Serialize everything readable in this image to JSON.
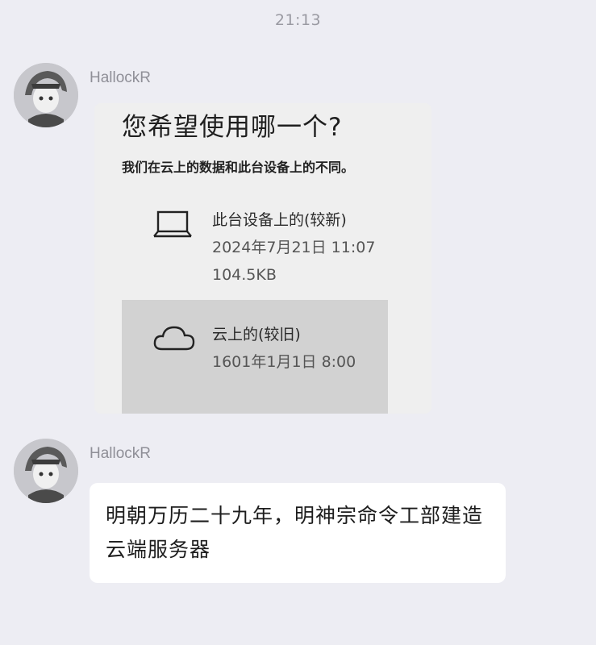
{
  "chat": {
    "timestamp": "21:13",
    "messages": [
      {
        "sender": "HallockR",
        "type": "image",
        "image": {
          "title": "您希望使用哪一个?",
          "subtitle": "我们在云上的数据和此台设备上的不同。",
          "options": [
            {
              "icon": "laptop-icon",
              "label": "此台设备上的(较新)",
              "date": "2024年7月21日 11:07",
              "size": "104.5KB"
            },
            {
              "icon": "cloud-icon",
              "label": "云上的(较旧)",
              "date": "1601年1月1日 8:00"
            }
          ]
        }
      },
      {
        "sender": "HallockR",
        "type": "text",
        "text": "明朝万历二十九年，明神宗命令工部建造云端服务器"
      }
    ]
  },
  "colors": {
    "background": "#ededf3",
    "bubble": "#ffffff",
    "selected_option": "#d2d2d2"
  }
}
